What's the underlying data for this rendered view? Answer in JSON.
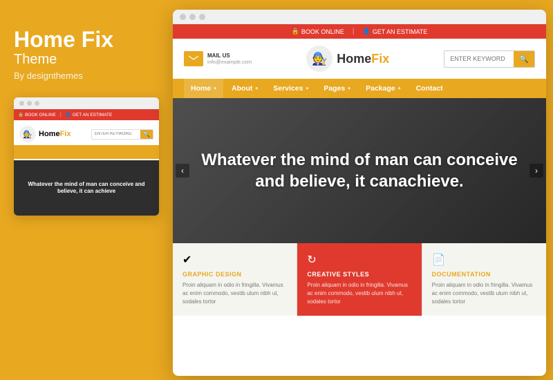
{
  "brand": {
    "title": "Home Fix",
    "subtitle": "Theme",
    "by": "By designthemes"
  },
  "mini_browser": {
    "topbar": {
      "book_online": "BOOK ONLINE",
      "get_estimate": "GET AN ESTIMATE"
    },
    "logo": "HomeFix",
    "search_placeholder": "ENTER KEYWORD",
    "hero_text": "Whatever the mind of man can conceive and believe, it can achieve"
  },
  "topbar": {
    "book_online": "BOOK ONLINE",
    "separator": "|",
    "get_estimate": "GET AN ESTIMATE"
  },
  "header": {
    "mail_label": "MAIL US",
    "mail_address": "info@example.com",
    "logo": "HomeFix",
    "search_placeholder": "ENTER KEYWORD"
  },
  "nav": {
    "items": [
      {
        "label": "Home",
        "active": true
      },
      {
        "label": "About",
        "active": false
      },
      {
        "label": "Services",
        "active": false
      },
      {
        "label": "Pages",
        "active": false
      },
      {
        "label": "Package",
        "active": false
      },
      {
        "label": "Contact",
        "active": false
      }
    ]
  },
  "hero": {
    "text": "Whatever the mind of man can conceive and believe, it canachieve."
  },
  "cards": [
    {
      "icon": "✔",
      "title": "GRAPHIC DESIGN",
      "body": "Proin aliquam in odio in fringilla. Vivamus ac enim commodo, vestib ulum nibh ut, sodales tortor"
    },
    {
      "icon": "↻",
      "title": "CREATIVE STYLES",
      "body": "Proin aliquam in odio in fringilla. Vivamus ac enim commodo, vestib ulum nibh ut, sodales tortor",
      "highlight": true
    },
    {
      "icon": "📄",
      "title": "DOCUMENTATION",
      "body": "Proin aliquam in odio in fringilla. Vivamus ac enim commodo, vestib ulum nibh ut, sodales tortor"
    }
  ]
}
